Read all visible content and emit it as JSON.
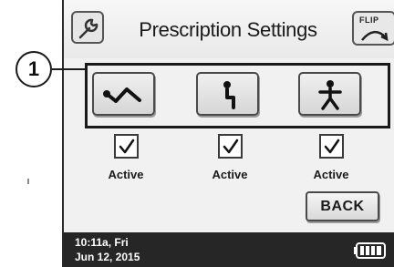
{
  "header": {
    "title": "Prescription Settings",
    "flip_label": "FLIP"
  },
  "callout": {
    "number": "1"
  },
  "modes": [
    {
      "icon": "wave-icon",
      "active_label": "Active",
      "checked": true
    },
    {
      "icon": "step-icon",
      "active_label": "Active",
      "checked": true
    },
    {
      "icon": "person-icon",
      "active_label": "Active",
      "checked": true
    }
  ],
  "back_label": "BACK",
  "status": {
    "time": "10:11a, Fri",
    "date": "Jun 12, 2015",
    "battery_icon": "battery-full-icon"
  },
  "colors": {
    "status_bar": "#262626",
    "screen_bg": "#f1f1f1"
  }
}
